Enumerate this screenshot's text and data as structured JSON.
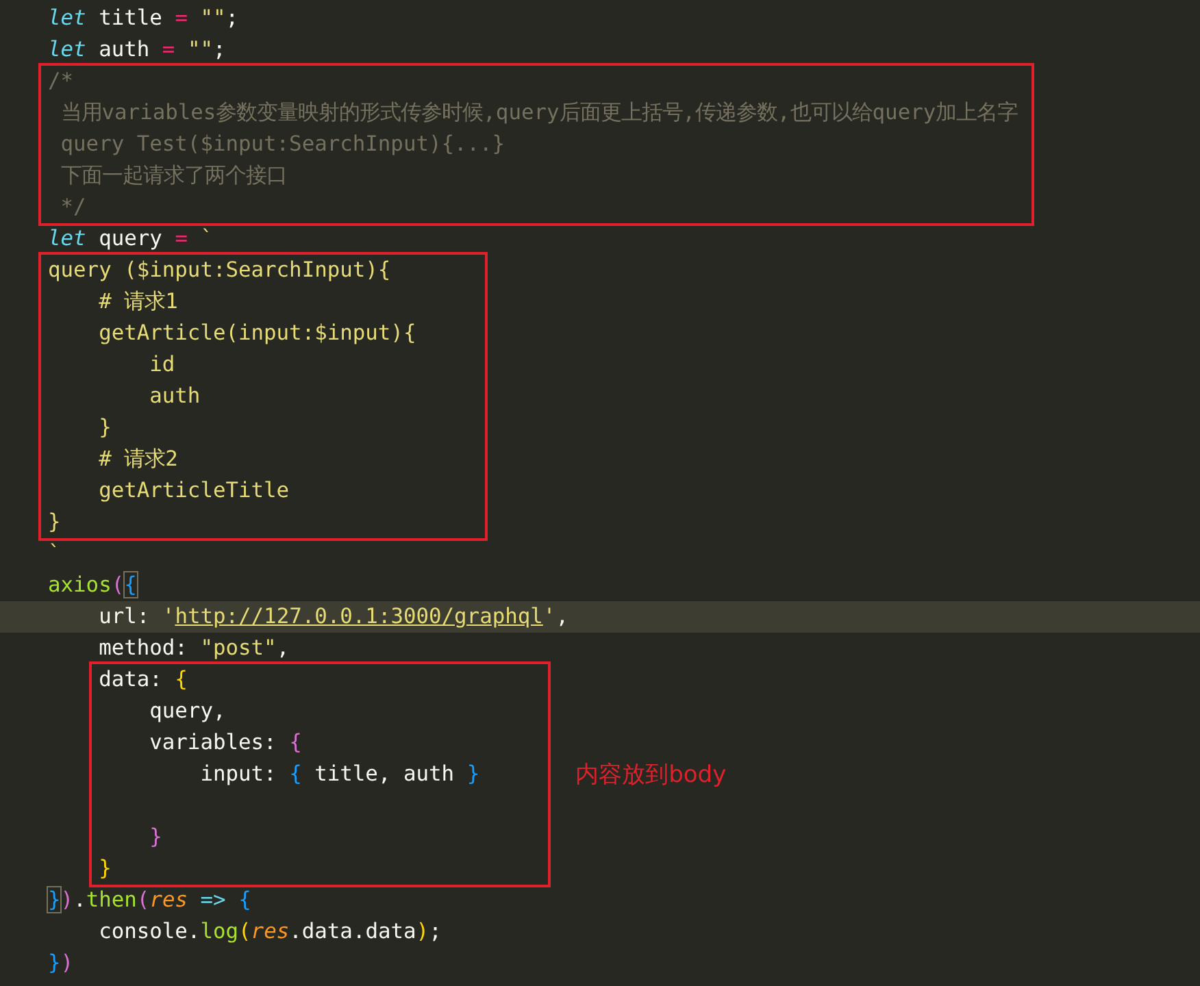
{
  "editor": {
    "items": [
      {
        "kind": "line",
        "tokens": [
          {
            "kind": "kw",
            "text": "let"
          },
          {
            "kind": "plain",
            "text": " title "
          },
          {
            "kind": "op",
            "text": "= "
          },
          {
            "kind": "str",
            "text": "\"\""
          },
          {
            "kind": "plain",
            "text": ";"
          }
        ]
      },
      {
        "kind": "line",
        "tokens": [
          {
            "kind": "kw",
            "text": "let"
          },
          {
            "kind": "plain",
            "text": " auth "
          },
          {
            "kind": "op",
            "text": "= "
          },
          {
            "kind": "str",
            "text": "\"\""
          },
          {
            "kind": "plain",
            "text": ";"
          }
        ]
      },
      {
        "kind": "boxed",
        "lines": [
          {
            "kind": "line",
            "tokens": [
              {
                "kind": "comment",
                "text": "/*"
              }
            ]
          },
          {
            "kind": "line",
            "tokens": [
              {
                "kind": "comment",
                "text": " 当用variables参数变量映射的形式传参时候,query后面更上括号,传递参数,也可以给query加上名字"
              }
            ]
          },
          {
            "kind": "line",
            "tokens": [
              {
                "kind": "comment",
                "text": " query Test($input:SearchInput){...}"
              }
            ]
          },
          {
            "kind": "line",
            "tokens": [
              {
                "kind": "comment",
                "text": " 下面一起请求了两个接口"
              }
            ]
          },
          {
            "kind": "line",
            "tokens": [
              {
                "kind": "comment",
                "text": " */"
              }
            ]
          }
        ]
      },
      {
        "kind": "line",
        "tokens": [
          {
            "kind": "kw",
            "text": "let"
          },
          {
            "kind": "plain",
            "text": " query "
          },
          {
            "kind": "op",
            "text": "= "
          },
          {
            "kind": "str",
            "text": "`"
          }
        ]
      },
      {
        "kind": "boxed",
        "lines": [
          {
            "kind": "line",
            "tokens": [
              {
                "kind": "gql",
                "text": "query ($input:SearchInput){"
              }
            ]
          },
          {
            "kind": "line",
            "tokens": [
              {
                "kind": "gql",
                "text": "    # 请求1"
              }
            ]
          },
          {
            "kind": "line",
            "tokens": [
              {
                "kind": "gql",
                "text": "    getArticle(input:$input){"
              }
            ]
          },
          {
            "kind": "line",
            "tokens": [
              {
                "kind": "gql",
                "text": "        id"
              }
            ]
          },
          {
            "kind": "line",
            "tokens": [
              {
                "kind": "gql",
                "text": "        auth"
              }
            ]
          },
          {
            "kind": "line",
            "tokens": [
              {
                "kind": "gql",
                "text": "    }"
              }
            ]
          },
          {
            "kind": "line",
            "tokens": [
              {
                "kind": "gql",
                "text": "    # 请求2"
              }
            ]
          },
          {
            "kind": "line",
            "tokens": [
              {
                "kind": "gql",
                "text": "    getArticleTitle"
              }
            ]
          },
          {
            "kind": "line",
            "tokens": [
              {
                "kind": "gql",
                "text": "}"
              }
            ]
          }
        ]
      },
      {
        "kind": "line",
        "tokens": [
          {
            "kind": "str",
            "text": "`"
          }
        ]
      },
      {
        "kind": "line",
        "tokens": [
          {
            "kind": "fn",
            "text": "axios"
          },
          {
            "kind": "b2",
            "text": "("
          },
          {
            "kind": "match",
            "text": "{"
          }
        ]
      },
      {
        "kind": "line",
        "current": true,
        "tokens": [
          {
            "kind": "plain",
            "text": "    url: "
          },
          {
            "kind": "str",
            "text": "'"
          },
          {
            "kind": "link",
            "text": "http://127.0.0.1:3000/graphql"
          },
          {
            "kind": "str",
            "text": "'"
          },
          {
            "kind": "plain",
            "text": ","
          }
        ]
      },
      {
        "kind": "line",
        "tokens": [
          {
            "kind": "plain",
            "text": "    method: "
          },
          {
            "kind": "str",
            "text": "\"post\""
          },
          {
            "kind": "plain",
            "text": ","
          }
        ]
      },
      {
        "kind": "boxed",
        "indented": true,
        "note": "内容放到body",
        "lines": [
          {
            "kind": "line",
            "tokens": [
              {
                "kind": "plain",
                "text": "data: "
              },
              {
                "kind": "b1",
                "text": "{"
              }
            ]
          },
          {
            "kind": "line",
            "tokens": [
              {
                "kind": "plain",
                "text": "    query,"
              }
            ]
          },
          {
            "kind": "line",
            "tokens": [
              {
                "kind": "plain",
                "text": "    variables: "
              },
              {
                "kind": "b2",
                "text": "{"
              }
            ]
          },
          {
            "kind": "line",
            "tokens": [
              {
                "kind": "plain",
                "text": "        input: "
              },
              {
                "kind": "b3",
                "text": "{"
              },
              {
                "kind": "plain",
                "text": " title, auth "
              },
              {
                "kind": "b3",
                "text": "}"
              }
            ]
          },
          {
            "kind": "blank"
          },
          {
            "kind": "line",
            "tokens": [
              {
                "kind": "b2",
                "text": "    }"
              }
            ]
          },
          {
            "kind": "line",
            "tokens": [
              {
                "kind": "b1",
                "text": "}"
              }
            ]
          }
        ]
      },
      {
        "kind": "line",
        "tokens": [
          {
            "kind": "match",
            "text": "}"
          },
          {
            "kind": "b2",
            "text": ")"
          },
          {
            "kind": "plain",
            "text": "."
          },
          {
            "kind": "fn",
            "text": "then"
          },
          {
            "kind": "b2",
            "text": "("
          },
          {
            "kind": "param",
            "text": "res "
          },
          {
            "kind": "arrow",
            "text": "=> "
          },
          {
            "kind": "b3",
            "text": "{"
          }
        ]
      },
      {
        "kind": "line",
        "tokens": [
          {
            "kind": "plain",
            "text": "    console."
          },
          {
            "kind": "fn",
            "text": "log"
          },
          {
            "kind": "b1",
            "text": "("
          },
          {
            "kind": "param",
            "text": "res"
          },
          {
            "kind": "plain",
            "text": ".data.data"
          },
          {
            "kind": "b1",
            "text": ")"
          },
          {
            "kind": "plain",
            "text": ";"
          }
        ]
      },
      {
        "kind": "line",
        "tokens": [
          {
            "kind": "b3",
            "text": "}"
          },
          {
            "kind": "b2",
            "text": ")"
          }
        ]
      }
    ]
  }
}
